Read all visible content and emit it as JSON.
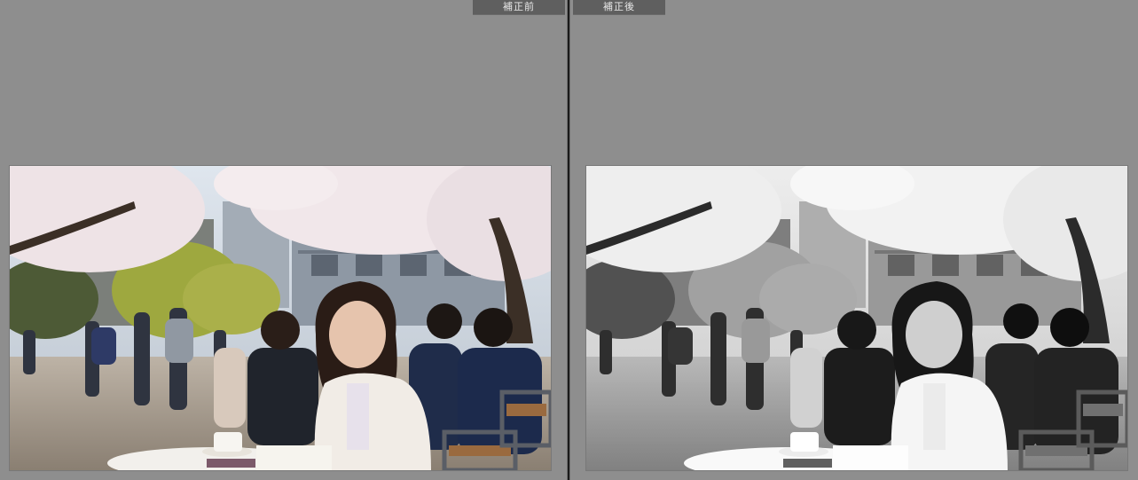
{
  "comparison": {
    "before_label": "補正前",
    "after_label": "補正後"
  },
  "photo": {
    "subject": "person-in-park-cafe",
    "before_mode": "color",
    "after_mode": "monochrome"
  },
  "colors": {
    "canvas_bg": "#8e8e8e",
    "label_bg": "#5f5f5f",
    "label_text": "#e8e8e8",
    "divider": "#1a1a1a"
  }
}
